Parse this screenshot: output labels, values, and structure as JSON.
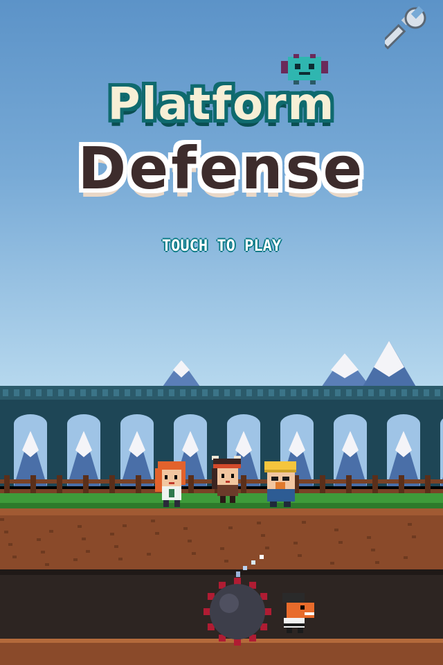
{
  "game": {
    "title_line1": "Platform",
    "title_line2": "Defense",
    "prompt": "TOUCH TO PLAY"
  },
  "icons": {
    "settings": "wrench-icon",
    "flying_enemy": "bat-monster-icon",
    "enemy": "spiked-mine-enemy",
    "enemy_runner": "orange-dino-enemy"
  },
  "heroes": [
    {
      "name": "redhead-girl",
      "hair": "#e2622c",
      "outfit": "#2f7a4d"
    },
    {
      "name": "viking-warrior",
      "hair": "#3b2420",
      "outfit": "#6b3b2a"
    },
    {
      "name": "miner-hero",
      "hair": "#f5c53d",
      "outfit": "#2d5c94"
    }
  ],
  "colors": {
    "title_outline": "#0f6a6e",
    "title_fill": "#f7efd6",
    "prompt_outline": "#0a7a86",
    "grass": "#3e9b3a",
    "dirt": "#8a4a2a",
    "castle": "#1e4656",
    "mine": "#3d3e4a",
    "spikes": "#b01c33"
  }
}
